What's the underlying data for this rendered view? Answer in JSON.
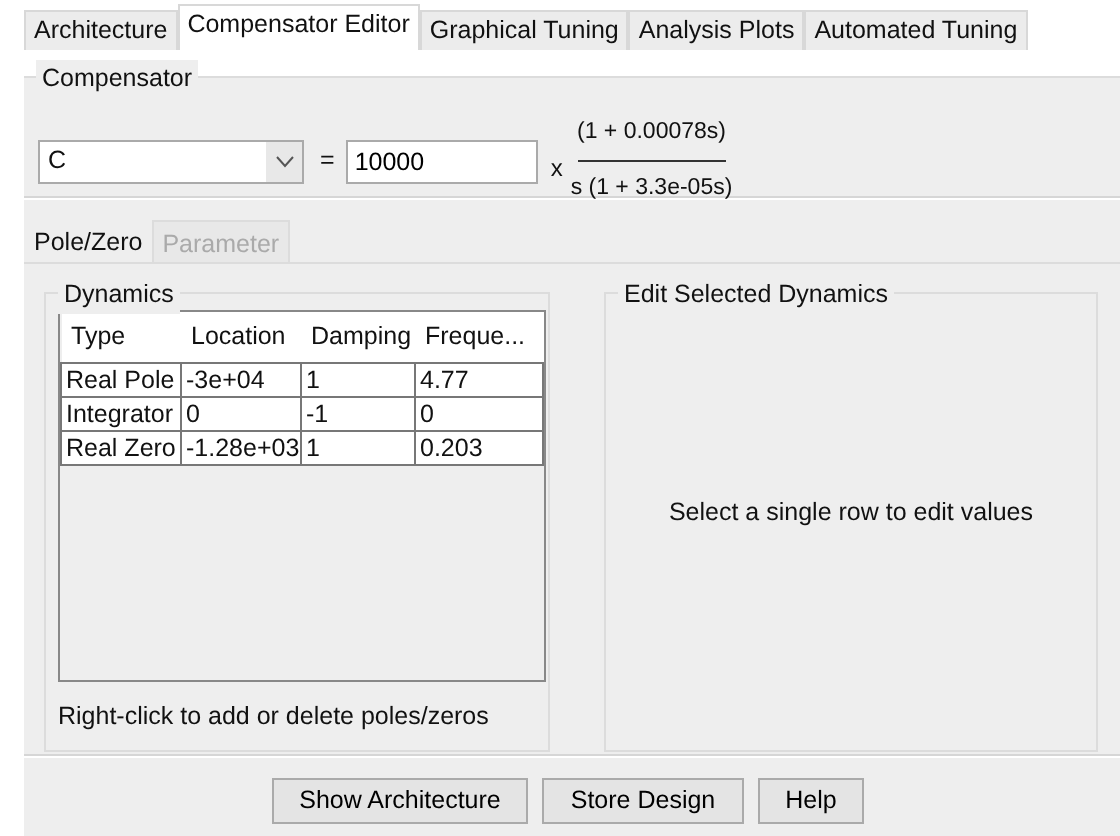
{
  "tabs": [
    {
      "label": "Architecture",
      "selected": false
    },
    {
      "label": "Compensator Editor",
      "selected": true
    },
    {
      "label": "Graphical Tuning",
      "selected": false
    },
    {
      "label": "Analysis Plots",
      "selected": false
    },
    {
      "label": "Automated Tuning",
      "selected": false
    }
  ],
  "compensator": {
    "title": "Compensator",
    "selector": "C",
    "equals": "=",
    "gain": "10000",
    "times": "x",
    "numerator": "(1 + 0.00078s)",
    "denominator": "s (1 + 3.3e-05s)"
  },
  "subtabs": [
    {
      "label": "Pole/Zero",
      "selected": true,
      "disabled": false
    },
    {
      "label": "Parameter",
      "selected": false,
      "disabled": true
    }
  ],
  "dynamics": {
    "title": "Dynamics",
    "columns": [
      "Type",
      "Location",
      "Damping",
      "Freque..."
    ],
    "rows": [
      [
        "Real Pole",
        "-3e+04",
        "1",
        "4.77"
      ],
      [
        "Integrator",
        "0",
        "-1",
        "0"
      ],
      [
        "Real Zero",
        "-1.28e+03",
        "1",
        "0.203"
      ]
    ],
    "hint": "Right-click to add or delete poles/zeros"
  },
  "edit": {
    "title": "Edit Selected Dynamics",
    "message": "Select a single row to edit values"
  },
  "buttons": [
    "Show Architecture",
    "Store Design",
    "Help"
  ]
}
